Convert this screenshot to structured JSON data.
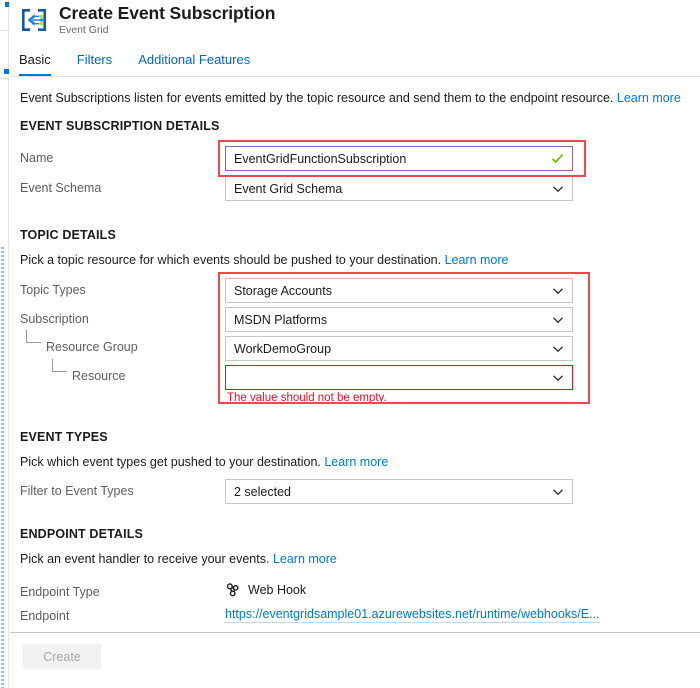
{
  "header": {
    "title": "Create Event Subscription",
    "subtitle": "Event Grid",
    "icon": "event-grid-icon"
  },
  "tabs": [
    {
      "label": "Basic",
      "active": true
    },
    {
      "label": "Filters",
      "active": false
    },
    {
      "label": "Additional Features",
      "active": false
    }
  ],
  "intro": {
    "text": "Event Subscriptions listen for events emitted by the topic resource and send them to the endpoint resource.",
    "link": "Learn more"
  },
  "sections": {
    "event_subscription_details": {
      "heading": "EVENT SUBSCRIPTION DETAILS",
      "fields": {
        "name": {
          "label": "Name",
          "value": "EventGridFunctionSubscription",
          "placeholder": "",
          "state": "valid",
          "validation_icon": "green-check-icon"
        },
        "event_schema": {
          "label": "Event Schema",
          "value": "Event Grid Schema"
        }
      }
    },
    "topic_details": {
      "heading": "TOPIC DETAILS",
      "description": "Pick a topic resource for which events should be pushed to your destination.",
      "link": "Learn more",
      "fields": {
        "topic_types": {
          "label": "Topic Types",
          "value": "Storage Accounts"
        },
        "subscription": {
          "label": "Subscription",
          "value": "MSDN Platforms"
        },
        "resource_group": {
          "label": "Resource Group",
          "value": "WorkDemoGroup"
        },
        "resource": {
          "label": "Resource",
          "value": "",
          "error": "The value should not be empty."
        }
      }
    },
    "event_types": {
      "heading": "EVENT TYPES",
      "description": "Pick which event types get pushed to your destination.",
      "link": "Learn more",
      "fields": {
        "filter_to_event_types": {
          "label": "Filter to Event Types",
          "value": "2 selected"
        }
      }
    },
    "endpoint_details": {
      "heading": "ENDPOINT DETAILS",
      "description": "Pick an event handler to receive your events.",
      "link": "Learn more",
      "fields": {
        "endpoint_type": {
          "label": "Endpoint Type",
          "value": "Web Hook",
          "icon": "webhook-icon"
        },
        "endpoint": {
          "label": "Endpoint",
          "value": "https://eventgridsample01.azurewebsites.net/runtime/webhooks/E..."
        }
      }
    }
  },
  "footer": {
    "create_label": "Create",
    "create_disabled": true
  },
  "colors": {
    "accent": "#0078d4",
    "link": "#0078d4",
    "error": "#e81123",
    "annotation": "#f1484a",
    "focus_border": "#8661c5",
    "valid_check": "#6bb700",
    "disabled_text": "#a6a6a6"
  }
}
